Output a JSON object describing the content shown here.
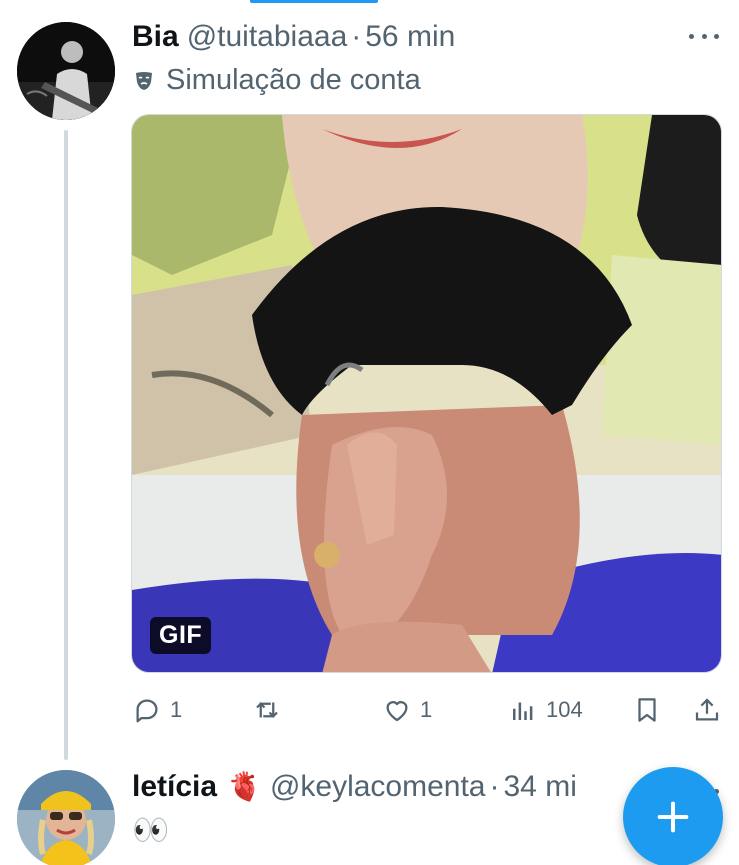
{
  "tweets": [
    {
      "display_name": "Bia",
      "handle": "@tuitabiaaa",
      "separator": "·",
      "time": "56 min",
      "parody_label": "Simulação de conta",
      "media_badge": "GIF",
      "reply_count": "1",
      "retweet_count": "",
      "like_count": "1",
      "view_count": "104"
    },
    {
      "display_name": "letícia",
      "name_emoji": "🫀",
      "handle": "@keylacomenta",
      "separator": "·",
      "time": "34 mi",
      "text": "👀"
    }
  ],
  "colors": {
    "accent": "#1d9bf0",
    "secondary_text": "#536471",
    "thread_line": "#cfd9de"
  },
  "icons": [
    "more-icon",
    "mask-icon",
    "reply-icon",
    "retweet-icon",
    "like-icon",
    "views-icon",
    "bookmark-icon",
    "share-icon",
    "compose-plus-icon"
  ]
}
